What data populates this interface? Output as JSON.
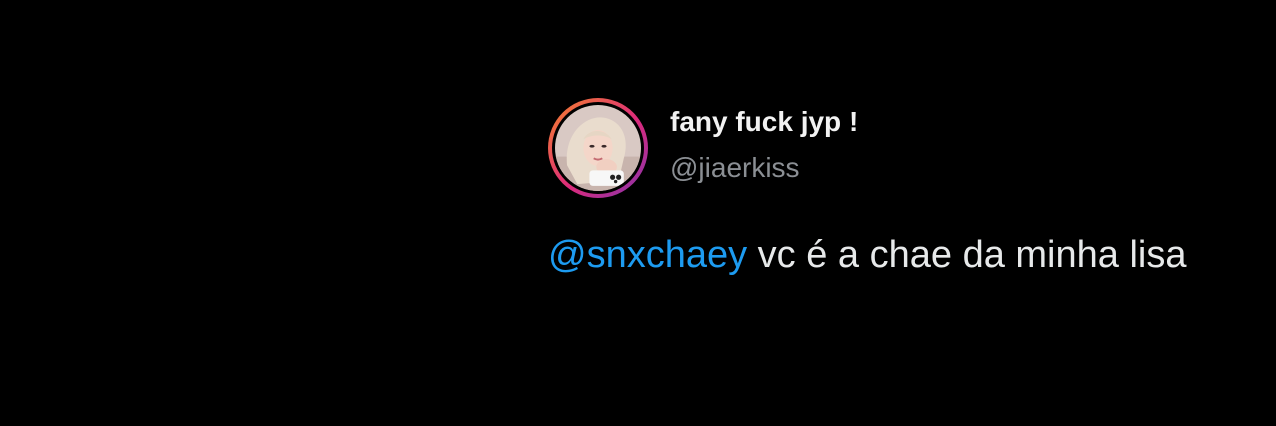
{
  "tweet": {
    "display_name": "fany fuck jyp !",
    "handle": "@jiaerkiss",
    "mention": "@snxchaey",
    "text": " vc é a chae da minha lisa",
    "avatar": "avatar-photo-icon"
  },
  "colors": {
    "background": "#000000",
    "display_name": "#f2f2f2",
    "handle": "#8b8f94",
    "body_text": "#e7e9ea",
    "mention": "#1d9bf0"
  }
}
